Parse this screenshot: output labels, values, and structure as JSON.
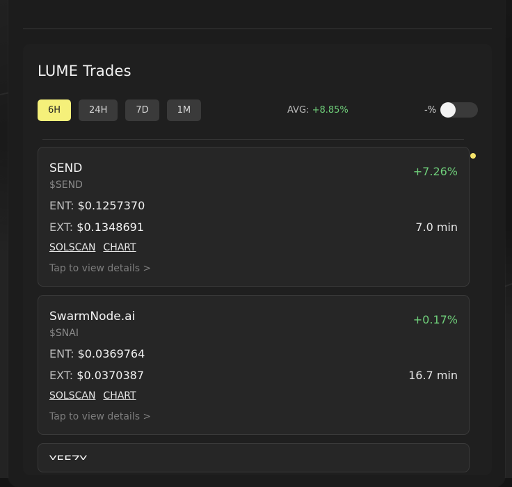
{
  "header": {
    "title": "LUME Trades"
  },
  "tabs": [
    {
      "label": "6H",
      "active": true
    },
    {
      "label": "24H",
      "active": false
    },
    {
      "label": "7D",
      "active": false
    },
    {
      "label": "1M",
      "active": false
    }
  ],
  "summary": {
    "avg_label": "AVG:",
    "avg_value": "+8.85%"
  },
  "toggle": {
    "label": "-%",
    "on": false
  },
  "links": {
    "solscan": "SOLSCAN",
    "chart": "CHART"
  },
  "trades": [
    {
      "name": "SEND",
      "symbol": "$SEND",
      "pct": "+7.26%",
      "ent_label": "ENT:",
      "ent": "$0.1257370",
      "ext_label": "EXT:",
      "ext": "$0.1348691",
      "duration": "7.0 min",
      "tap": "Tap to view details >"
    },
    {
      "name": "SwarmNode.ai",
      "symbol": "$SNAI",
      "pct": "+0.17%",
      "ent_label": "ENT:",
      "ent": "$0.0369764",
      "ext_label": "EXT:",
      "ext": "$0.0370387",
      "duration": "16.7 min",
      "tap": "Tap to view details >"
    },
    {
      "name": "YEEZY"
    }
  ],
  "colors": {
    "accent": "#f5f07a",
    "positive": "#6fcf7a",
    "indicator": "#f5e36a"
  }
}
